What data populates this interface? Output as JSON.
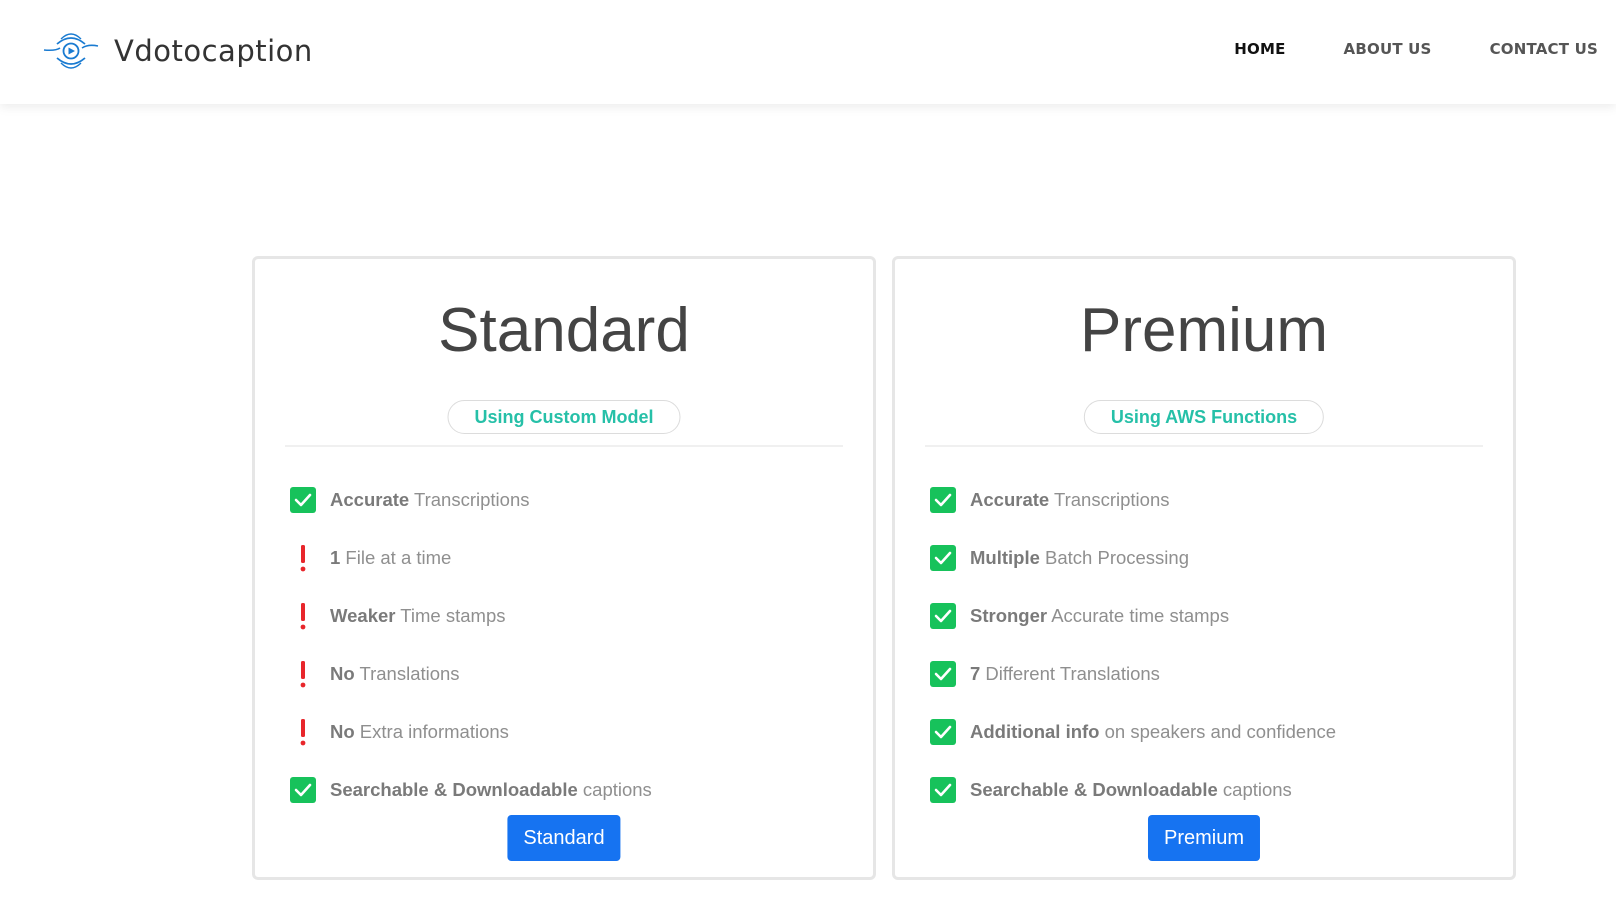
{
  "brand": {
    "name": "Vdotocaption",
    "logo_icon": "eye-play-logo-icon",
    "logo_color": "#1a7bd1"
  },
  "nav": {
    "items": [
      {
        "label": "HOME",
        "active": true
      },
      {
        "label": "ABOUT US",
        "active": false
      },
      {
        "label": "CONTACT US",
        "active": false
      }
    ]
  },
  "plans": [
    {
      "title": "Standard",
      "badge": "Using Custom Model",
      "features": [
        {
          "status": "check",
          "bold": "Accurate",
          "rest": " Transcriptions"
        },
        {
          "status": "warn",
          "bold": "1",
          "rest": " File at a time"
        },
        {
          "status": "warn",
          "bold": "Weaker",
          "rest": " Time stamps"
        },
        {
          "status": "warn",
          "bold": "No",
          "rest": " Translations"
        },
        {
          "status": "warn",
          "bold": "No",
          "rest": " Extra informations"
        },
        {
          "status": "check",
          "bold": "Searchable & Downloadable",
          "rest": " captions"
        }
      ],
      "button": "Standard"
    },
    {
      "title": "Premium",
      "badge": "Using AWS Functions",
      "features": [
        {
          "status": "check",
          "bold": "Accurate",
          "rest": " Transcriptions"
        },
        {
          "status": "check",
          "bold": "Multiple",
          "rest": " Batch Processing"
        },
        {
          "status": "check",
          "bold": "Stronger",
          "rest": " Accurate time stamps"
        },
        {
          "status": "check",
          "bold": "7",
          "rest": " Different Translations"
        },
        {
          "status": "check",
          "bold": "Additional info",
          "rest": " on speakers and confidence"
        },
        {
          "status": "check",
          "bold": "Searchable & Downloadable",
          "rest": " captions"
        }
      ],
      "button": "Premium"
    }
  ],
  "colors": {
    "accent_badge": "#26c0a8",
    "button": "#1673f1",
    "check": "#17c25b",
    "warning": "#e8262b"
  }
}
